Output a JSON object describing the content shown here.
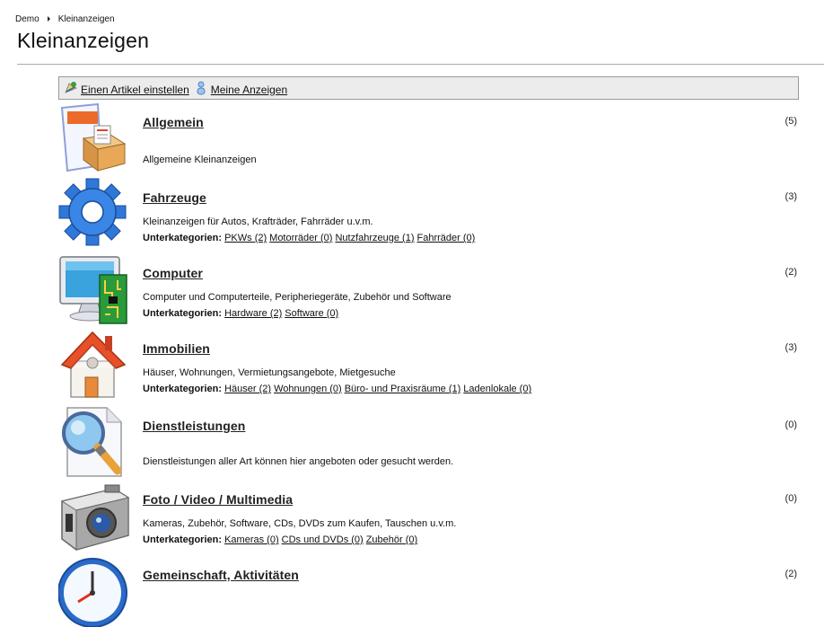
{
  "breadcrumb": {
    "items": [
      "Demo",
      "Kleinanzeigen"
    ]
  },
  "page": {
    "title": "Kleinanzeigen"
  },
  "toolbar": {
    "add_label": "Einen Artikel einstellen",
    "my_ads_label": "Meine Anzeigen"
  },
  "subcategories_label": "Unterkategorien:",
  "categories": [
    {
      "title": "Allgemein",
      "count": "(5)",
      "description": "Allgemeine Kleinanzeigen",
      "icon": "box-document-icon",
      "subs": []
    },
    {
      "title": "Fahrzeuge",
      "count": "(3)",
      "description": "Kleinanzeigen für Autos, Krafträder, Fahrräder u.v.m.",
      "icon": "gear-icon",
      "subs": [
        "PKWs (2)",
        "Motorräder (0)",
        "Nutzfahrzeuge (1)",
        "Fahrräder (0)"
      ]
    },
    {
      "title": "Computer",
      "count": "(2)",
      "description": "Computer und Computerteile, Peripheriegeräte, Zubehör und Software",
      "icon": "computer-icon",
      "subs": [
        "Hardware (2)",
        "Software (0)"
      ]
    },
    {
      "title": "Immobilien",
      "count": "(3)",
      "description": "Häuser, Wohnungen, Vermietungsangebote, Mietgesuche",
      "icon": "house-icon",
      "subs": [
        "Häuser (2)",
        "Wohnungen (0)",
        "Büro- und Praxisräume (1)",
        "Ladenlokale (0)"
      ]
    },
    {
      "title": "Dienstleistungen",
      "count": "(0)",
      "description": "Dienstleistungen aller Art können hier angeboten oder gesucht werden.",
      "icon": "magnifier-icon",
      "subs": []
    },
    {
      "title": "Foto / Video / Multimedia",
      "count": "(0)",
      "description": "Kameras, Zubehör, Software, CDs, DVDs zum Kaufen, Tauschen u.v.m.",
      "icon": "camera-icon",
      "subs": [
        "Kameras (0)",
        "CDs und DVDs (0)",
        "Zubehör (0)"
      ]
    },
    {
      "title": "Gemeinschaft, Aktivitäten",
      "count": "(2)",
      "description": "",
      "icon": "clock-icon",
      "subs": []
    }
  ]
}
